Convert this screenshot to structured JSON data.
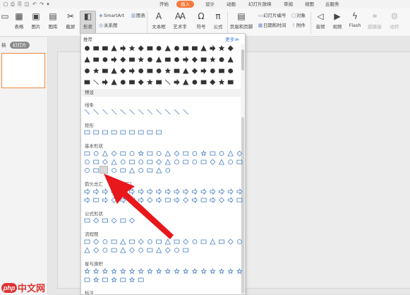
{
  "menu": {
    "tabs": [
      "开始",
      "插入",
      "设计",
      "动画",
      "幻灯片放映",
      "审阅",
      "视图",
      "云服务"
    ],
    "active_tab": "插入",
    "accent_color": "#f47a3c"
  },
  "ribbon": {
    "buttons": {
      "new_slide": "",
      "table": "表格",
      "picture": "图片",
      "gallery": "图库",
      "screenshot": "截屏",
      "shapes": "形状",
      "textbox": "文本框",
      "wordart": "艺术字",
      "symbol": "符号",
      "formula": "公式",
      "audio": "音频",
      "video": "视频",
      "flash": "Flash",
      "hyperlink": "超链接",
      "action": "动作"
    },
    "smartart": "SmartArt",
    "chart": "图表",
    "relation": "关系图",
    "header_footer": "页眉和页脚",
    "slide_number": "幻灯片编号",
    "object": "对象",
    "datetime": "日期和时间",
    "attachment": "附件"
  },
  "left_panel": {
    "tabs": [
      "稿",
      "幻灯片"
    ],
    "active_tab": "幻灯片"
  },
  "shapes_dropdown": {
    "recent_label": "推荐",
    "more_link": "更多≫",
    "preset_label": "预设",
    "categories": [
      "线条",
      "矩形",
      "基本形状",
      "箭头总汇",
      "公式形状",
      "流程图",
      "星与旗帜",
      "标注"
    ],
    "tooltip": "笑脸"
  },
  "watermark": {
    "logo_text": "php",
    "site_text": "中文网"
  }
}
